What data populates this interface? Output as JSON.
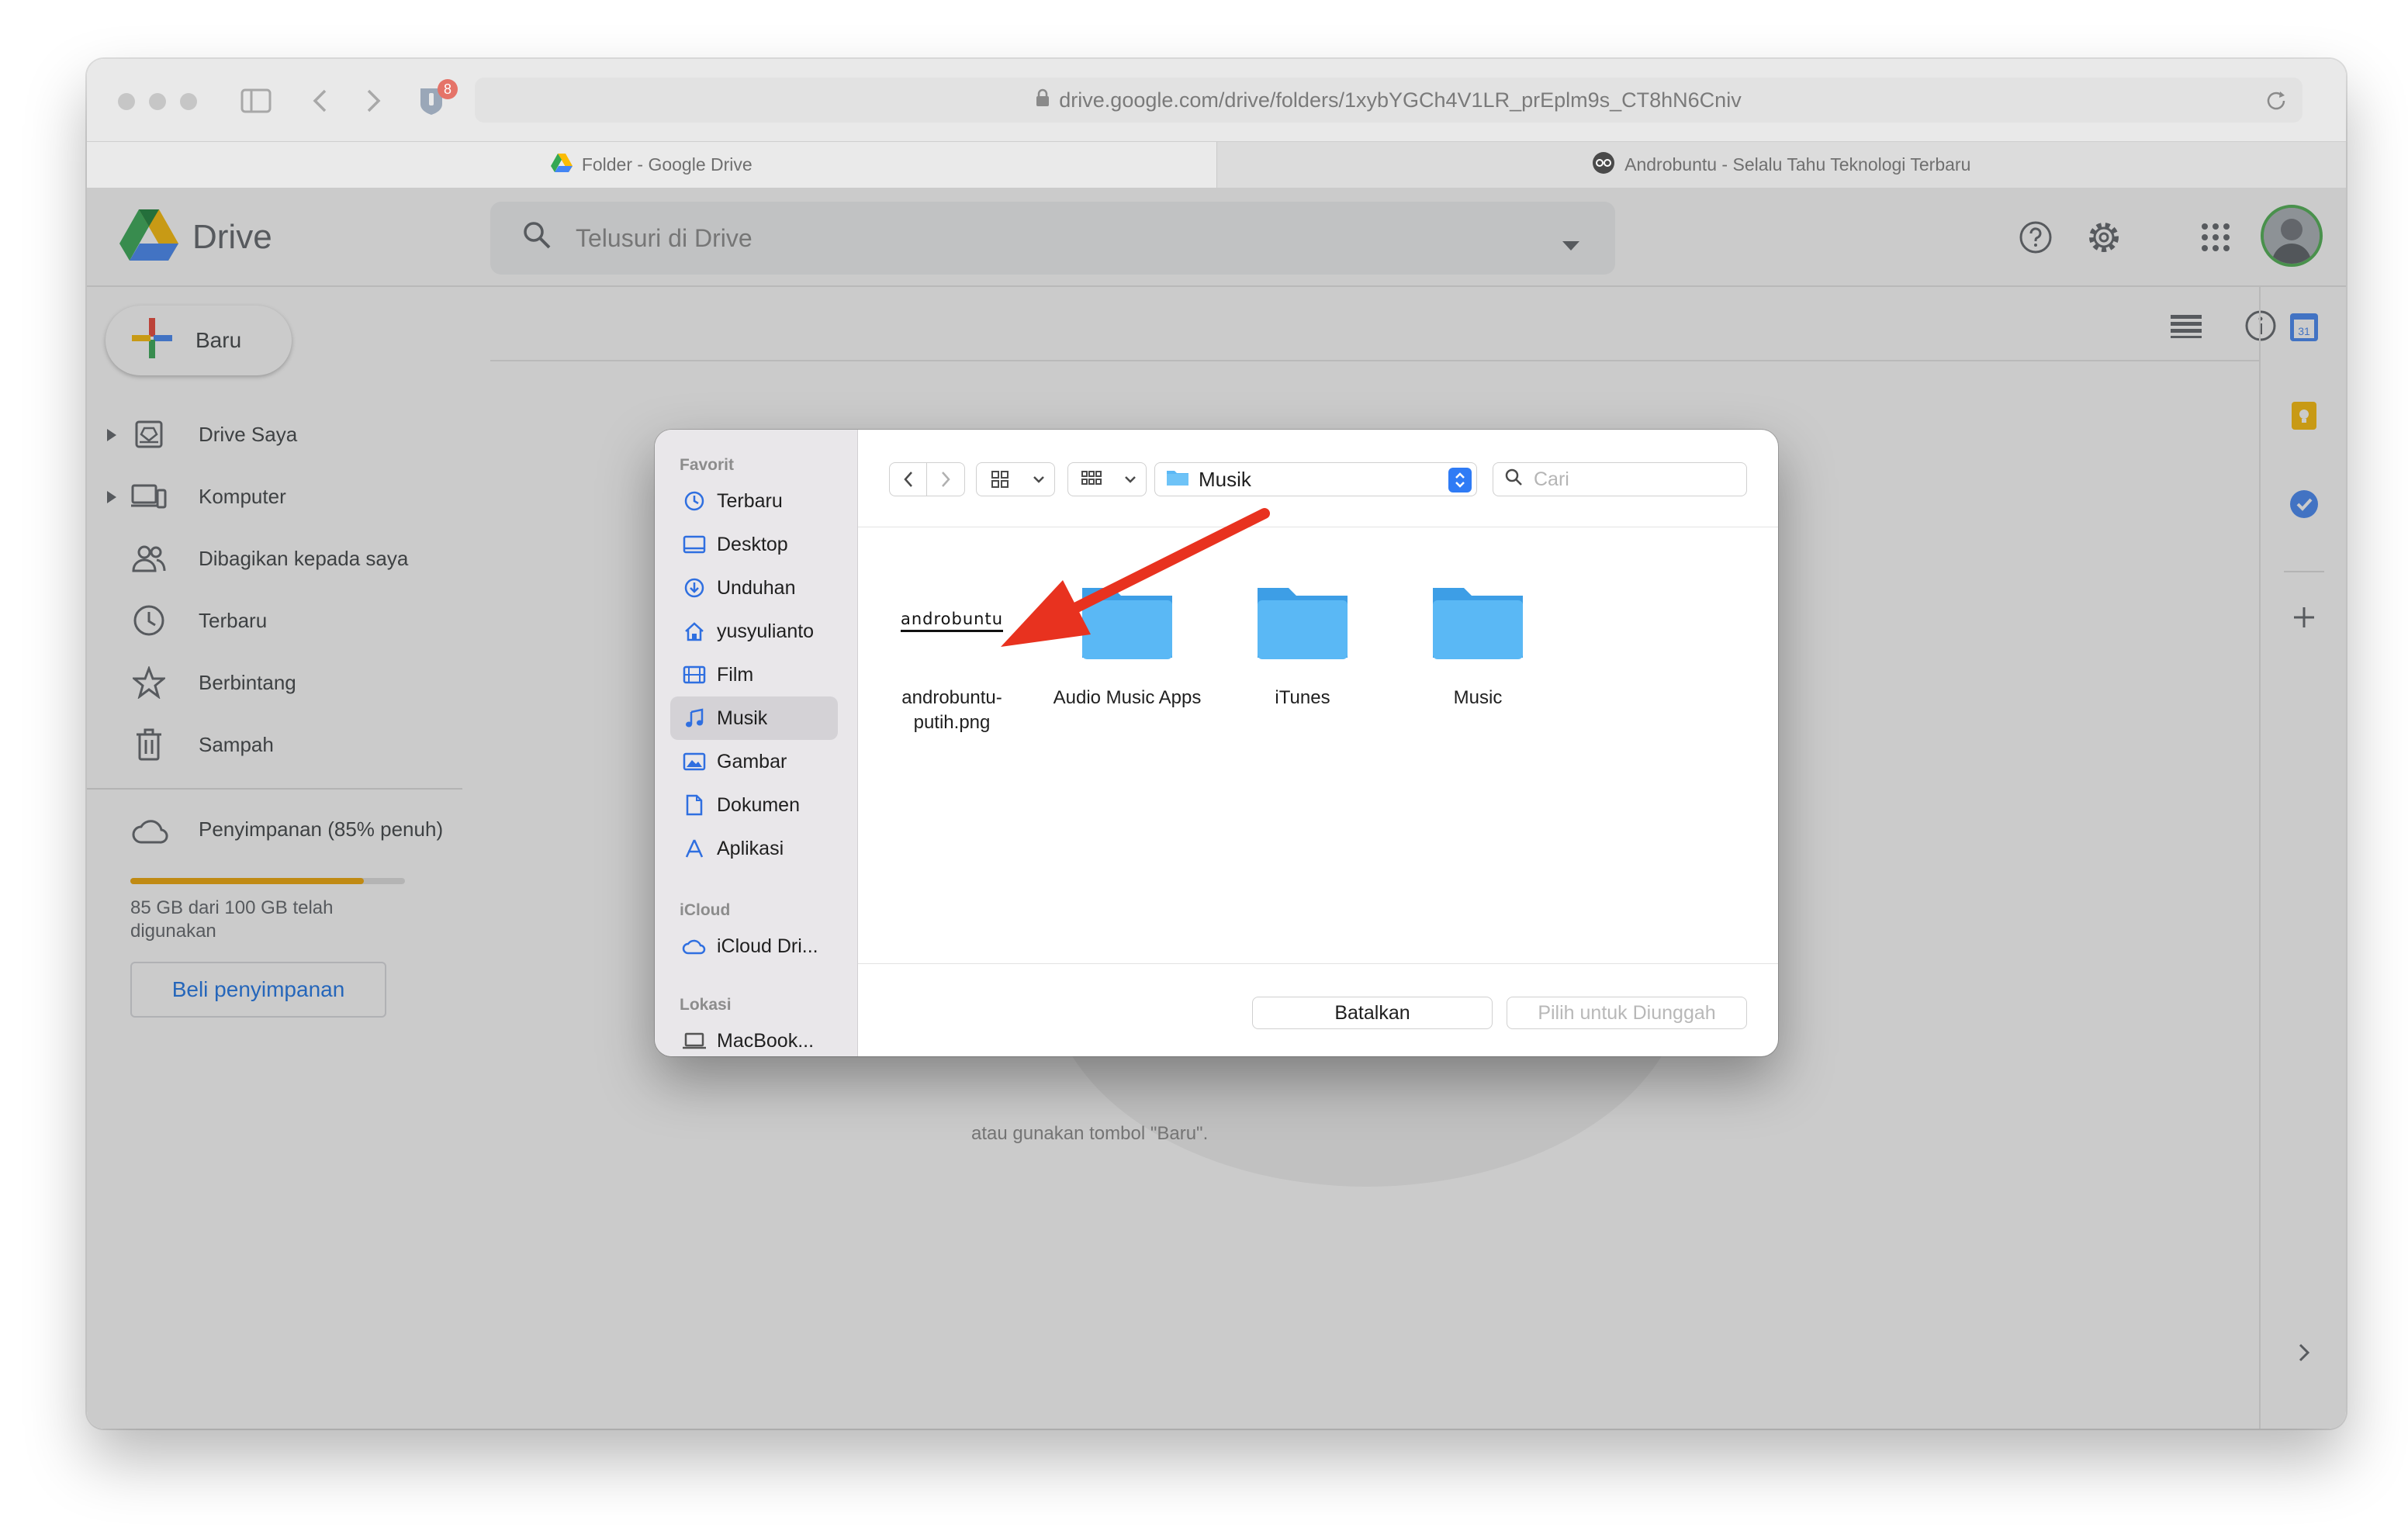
{
  "browser": {
    "url": "drive.google.com/drive/folders/1xybYGCh4V1LR_prEplm9s_CT8hN6Cniv",
    "badge_count": "8",
    "tabs": [
      {
        "label": "Folder - Google Drive"
      },
      {
        "label": "Androbuntu - Selalu Tahu Teknologi Terbaru"
      }
    ]
  },
  "drive": {
    "logo_text": "Drive",
    "search_placeholder": "Telusuri di Drive",
    "new_label": "Baru",
    "nav": [
      {
        "label": "Drive Saya",
        "icon": "my-drive-icon"
      },
      {
        "label": "Komputer",
        "icon": "computers-icon"
      },
      {
        "label": "Dibagikan kepada saya",
        "icon": "shared-icon"
      },
      {
        "label": "Terbaru",
        "icon": "clock-icon"
      },
      {
        "label": "Berbintang",
        "icon": "star-icon"
      },
      {
        "label": "Sampah",
        "icon": "trash-icon"
      }
    ],
    "storage_title": "Penyimpanan (85% penuh)",
    "storage_fraction": 0.85,
    "storage_text": "85 GB dari 100 GB telah digunakan",
    "buy_label": "Beli penyimpanan",
    "hint": "atau gunakan tombol \"Baru\".",
    "accent": "#1a73e8"
  },
  "dialog": {
    "sections": {
      "favorites": "Favorit",
      "icloud": "iCloud",
      "locations": "Lokasi"
    },
    "favorites": [
      {
        "label": "Terbaru",
        "icon": "clock-icon"
      },
      {
        "label": "Desktop",
        "icon": "desktop-icon"
      },
      {
        "label": "Unduhan",
        "icon": "download-icon"
      },
      {
        "label": "yusyulianto",
        "icon": "home-icon"
      },
      {
        "label": "Film",
        "icon": "film-icon"
      },
      {
        "label": "Musik",
        "icon": "music-icon"
      },
      {
        "label": "Gambar",
        "icon": "photo-icon"
      },
      {
        "label": "Dokumen",
        "icon": "document-icon"
      },
      {
        "label": "Aplikasi",
        "icon": "apps-icon"
      }
    ],
    "selected_favorite": "Musik",
    "icloud_item": "iCloud Dri...",
    "location_item": "MacBook...",
    "location_folder": "Musik",
    "search_placeholder": "Cari",
    "files": [
      {
        "name": "androbuntu-putih.png",
        "line1": "androbuntu-",
        "line2": "putih.png",
        "thumb_text": "androbuntu"
      },
      {
        "name": "Audio Music Apps"
      },
      {
        "name": "iTunes"
      },
      {
        "name": "Music"
      }
    ],
    "cancel_label": "Batalkan",
    "choose_label": "Pilih untuk Diunggah",
    "folder_color": "#5ab8f5",
    "arrow_color": "#e8321f"
  }
}
